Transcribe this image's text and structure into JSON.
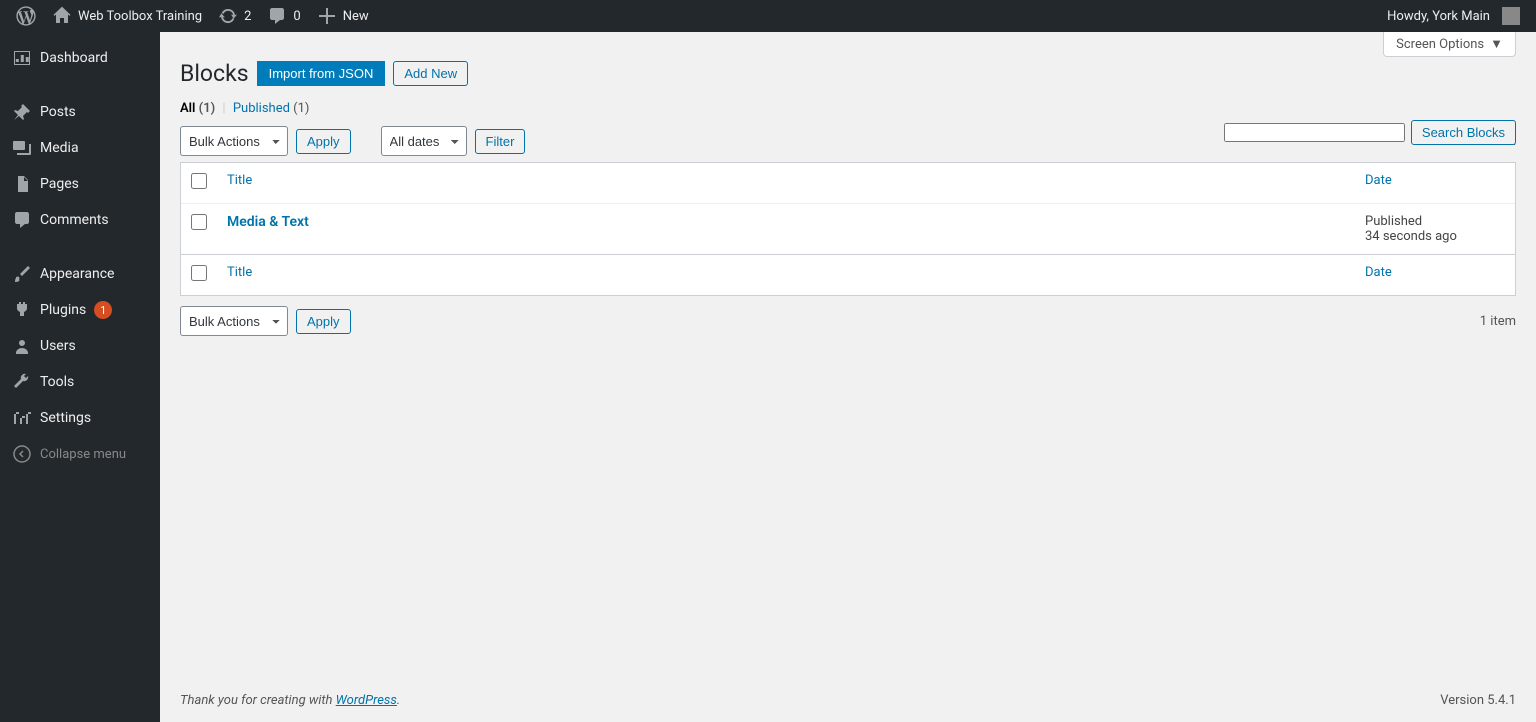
{
  "adminbar": {
    "site_name": "Web Toolbox Training",
    "updates_count": "2",
    "comments_count": "0",
    "new_label": "New",
    "howdy": "Howdy, York Main"
  },
  "sidebar": {
    "dashboard": "Dashboard",
    "posts": "Posts",
    "media": "Media",
    "pages": "Pages",
    "comments": "Comments",
    "appearance": "Appearance",
    "plugins": "Plugins",
    "plugins_badge": "1",
    "users": "Users",
    "tools": "Tools",
    "settings": "Settings",
    "collapse": "Collapse menu"
  },
  "page": {
    "screen_options": "Screen Options",
    "title": "Blocks",
    "import_btn": "Import from JSON",
    "addnew_btn": "Add New",
    "filters": {
      "all_label": "All",
      "all_count": "(1)",
      "published_label": "Published",
      "published_count": "(1)"
    },
    "bulk_actions": "Bulk Actions",
    "apply": "Apply",
    "all_dates": "All dates",
    "filter": "Filter",
    "item_count": "1 item",
    "search_btn": "Search Blocks",
    "table": {
      "title_col": "Title",
      "date_col": "Date",
      "rows": [
        {
          "title": "Media & Text",
          "date_status": "Published",
          "date_relative": "34 seconds ago"
        }
      ]
    }
  },
  "footer": {
    "thankyou": "Thank you for creating with ",
    "wp": "WordPress",
    "version": "Version 5.4.1"
  }
}
